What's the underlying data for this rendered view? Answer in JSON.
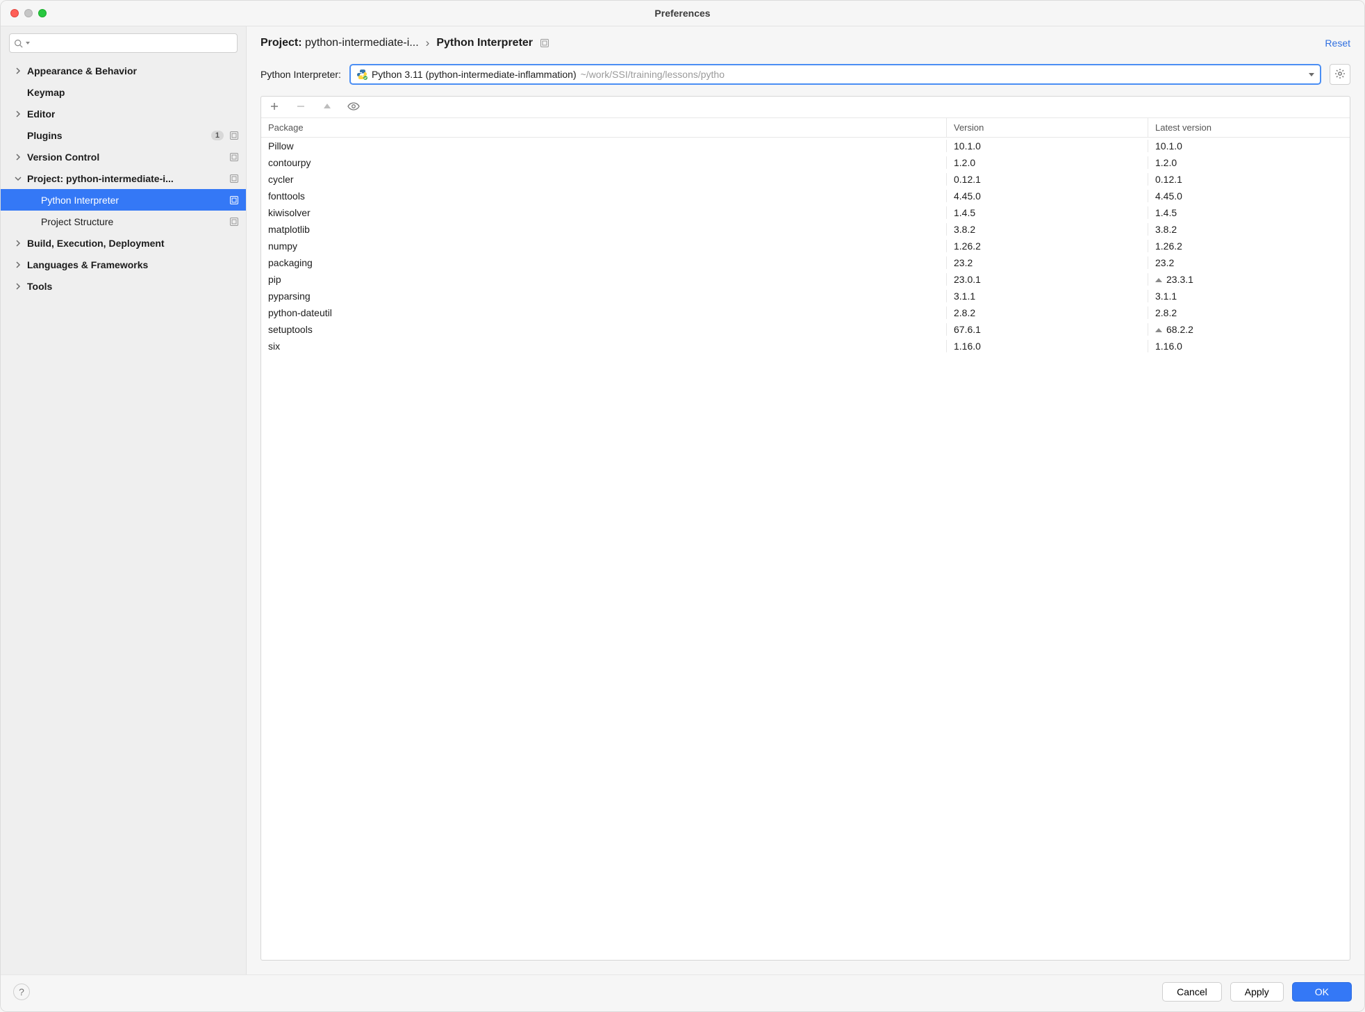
{
  "window": {
    "title": "Preferences"
  },
  "sidebar": {
    "search_placeholder": "",
    "items": [
      {
        "label": "Appearance & Behavior",
        "disclosure": "›"
      },
      {
        "label": "Keymap",
        "disclosure": ""
      },
      {
        "label": "Editor",
        "disclosure": "›"
      },
      {
        "label": "Plugins",
        "disclosure": "",
        "count": "1",
        "glyph": true
      },
      {
        "label": "Version Control",
        "disclosure": "›",
        "glyph": true
      },
      {
        "label": "Project: python-intermediate-i...",
        "disclosure": "⌄",
        "glyph": true
      },
      {
        "label": "Python Interpreter",
        "child": true,
        "selected": true,
        "glyph": true
      },
      {
        "label": "Project Structure",
        "child": true,
        "glyph": true
      },
      {
        "label": "Build, Execution, Deployment",
        "disclosure": "›"
      },
      {
        "label": "Languages & Frameworks",
        "disclosure": "›"
      },
      {
        "label": "Tools",
        "disclosure": "›"
      }
    ]
  },
  "crumbs": {
    "project_prefix": "Project: ",
    "project_name": "python-intermediate-i...",
    "sep": "›",
    "page": "Python Interpreter",
    "reset": "Reset"
  },
  "interpreter": {
    "label": "Python Interpreter:",
    "name": "Python 3.11 (python-intermediate-inflammation)",
    "path": "~/work/SSI/training/lessons/pytho"
  },
  "packages": {
    "header_pkg": "Package",
    "header_ver": "Version",
    "header_lat": "Latest version",
    "rows": [
      {
        "name": "Pillow",
        "version": "10.1.0",
        "latest": "10.1.0"
      },
      {
        "name": "contourpy",
        "version": "1.2.0",
        "latest": "1.2.0"
      },
      {
        "name": "cycler",
        "version": "0.12.1",
        "latest": "0.12.1"
      },
      {
        "name": "fonttools",
        "version": "4.45.0",
        "latest": "4.45.0"
      },
      {
        "name": "kiwisolver",
        "version": "1.4.5",
        "latest": "1.4.5"
      },
      {
        "name": "matplotlib",
        "version": "3.8.2",
        "latest": "3.8.2"
      },
      {
        "name": "numpy",
        "version": "1.26.2",
        "latest": "1.26.2"
      },
      {
        "name": "packaging",
        "version": "23.2",
        "latest": "23.2"
      },
      {
        "name": "pip",
        "version": "23.0.1",
        "latest": "23.3.1",
        "upgrade": true
      },
      {
        "name": "pyparsing",
        "version": "3.1.1",
        "latest": "3.1.1"
      },
      {
        "name": "python-dateutil",
        "version": "2.8.2",
        "latest": "2.8.2"
      },
      {
        "name": "setuptools",
        "version": "67.6.1",
        "latest": "68.2.2",
        "upgrade": true
      },
      {
        "name": "six",
        "version": "1.16.0",
        "latest": "1.16.0"
      }
    ]
  },
  "footer": {
    "cancel": "Cancel",
    "apply": "Apply",
    "ok": "OK"
  }
}
